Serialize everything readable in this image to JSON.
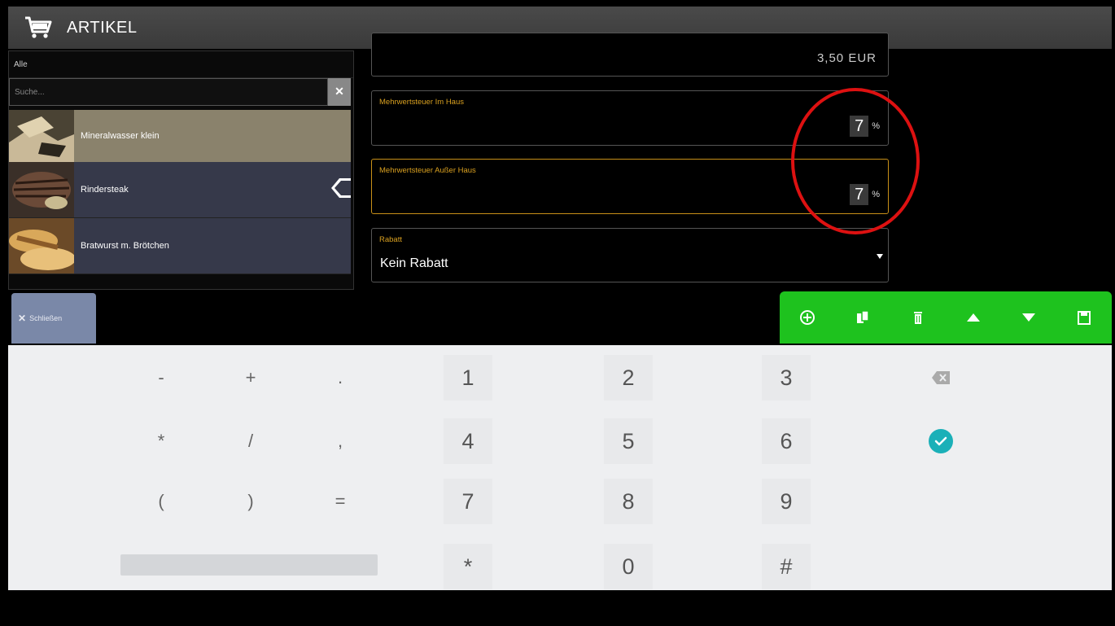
{
  "app": {
    "title": "ARTIKEL"
  },
  "left_panel": {
    "category": "Alle",
    "search_placeholder": "Suche...",
    "clear_label": "✕",
    "articles": [
      {
        "name": "Mineralwasser klein",
        "selected": true
      },
      {
        "name": "Rindersteak",
        "selected": false
      },
      {
        "name": "Bratwurst m. Brötchen",
        "selected": false
      }
    ],
    "close_button": {
      "icon": "close-icon",
      "label": "Schließen"
    }
  },
  "form": {
    "price": {
      "value": "3,50 EUR"
    },
    "vat_in_house": {
      "label": "Mehrwertsteuer Im Haus",
      "value": "7",
      "unit": "%"
    },
    "vat_out_of_house": {
      "label": "Mehrwertsteuer Außer Haus",
      "value": "7",
      "unit": "%"
    },
    "discount": {
      "label": "Rabatt",
      "value": "Kein Rabatt"
    }
  },
  "toolbar": {
    "icons": [
      "add-icon",
      "copy-icon",
      "delete-icon",
      "move-up-icon",
      "move-down-icon",
      "save-icon"
    ],
    "color": "#1ec21e"
  },
  "keyboard": {
    "row1": [
      "-",
      "+",
      ".",
      "1",
      "2",
      "3"
    ],
    "row2": [
      "*",
      "/",
      ",",
      "4",
      "5",
      "6"
    ],
    "row3": [
      "(",
      ")",
      "=",
      "7",
      "8",
      "9"
    ],
    "row4": [
      "*",
      "0",
      "#"
    ],
    "backspace_icon": "backspace-icon",
    "confirm_icon": "check-circle-icon",
    "confirm_color": "#1bb0b8"
  },
  "colors": {
    "accent_orange": "#d9a020",
    "highlight_red": "#dd1111",
    "selected_item": "#8a826c",
    "list_item": "#36394a"
  }
}
